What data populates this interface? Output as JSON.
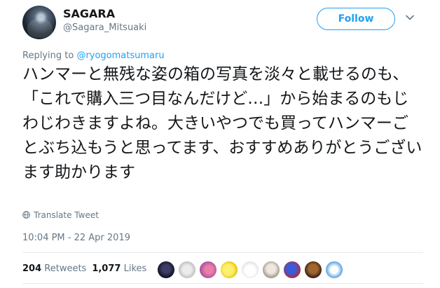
{
  "user": {
    "display_name": "SAGARA",
    "handle": "@Sagara_Mitsuaki"
  },
  "header": {
    "follow_label": "Follow",
    "menu_icon": "chevron-down-icon"
  },
  "reply": {
    "prefix": "Replying to ",
    "target": "@ryogomatsumaru"
  },
  "tweet": {
    "text": "ハンマーと無残な姿の箱の写真を淡々と載せるのも、「これで購入三つ目なんだけど…」から始まるのもじわじわきますよね。大きいやつでも買ってハンマーごとぶち込もうと思ってます、おすすめありがとうございます助かります"
  },
  "translate": {
    "label": "Translate Tweet",
    "icon": "globe-icon"
  },
  "timestamp": "10:04 PM - 22 Apr 2019",
  "stats": {
    "retweets_count": "204",
    "retweets_label": "Retweets",
    "likes_count": "1,077",
    "likes_label": "Likes"
  },
  "colors": {
    "accent": "#1da1f2",
    "muted": "#657786",
    "text": "#14171a",
    "divider": "#e6ecf0"
  }
}
